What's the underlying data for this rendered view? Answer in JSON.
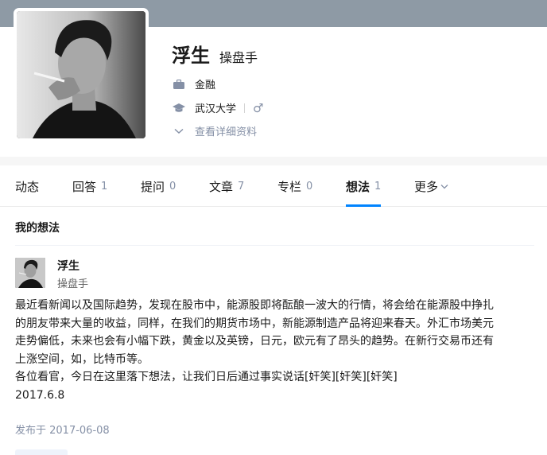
{
  "profile": {
    "name": "浮生",
    "headline": "操盘手",
    "industry": "金融",
    "school": "武汉大学",
    "gender_symbol": "♂",
    "detail_link": "查看详细资料"
  },
  "icons": {
    "industry": "briefcase-icon",
    "school": "graduation-cap-icon",
    "detail": "chevron-down-icon"
  },
  "tabs": [
    {
      "label": "动态",
      "count": ""
    },
    {
      "label": "回答",
      "count": "1"
    },
    {
      "label": "提问",
      "count": "0"
    },
    {
      "label": "文章",
      "count": "7"
    },
    {
      "label": "专栏",
      "count": "0"
    },
    {
      "label": "想法",
      "count": "1"
    },
    {
      "label": "更多",
      "count": ""
    }
  ],
  "active_tab": "想法",
  "section": {
    "title": "我的想法"
  },
  "post": {
    "author": "浮生",
    "author_headline": "操盘手",
    "body_lines": [
      "最近看新闻以及国际趋势，发现在股市中，能源股即将酝酿一波大的行情，将会给在能源股中挣扎",
      "的朋友带来大量的收益，同样，在我们的期货市场中，新能源制造产品将迎来春天。外汇市场美元",
      "走势偏低，未来也会有小幅下跌，黄金以及英镑，日元，欧元有了昂头的趋势。在新行交易币还有",
      "上涨空间，如，比特币等。",
      "各位看官，今日在这里落下想法，让我们日后通过事实说话[奸笑][奸笑][奸笑]",
      "2017.6.8"
    ],
    "published": "发布于 2017-06-08"
  },
  "colors": {
    "accent": "#0084ff",
    "muted": "#8590a6",
    "cover": "#8e9aa5"
  }
}
